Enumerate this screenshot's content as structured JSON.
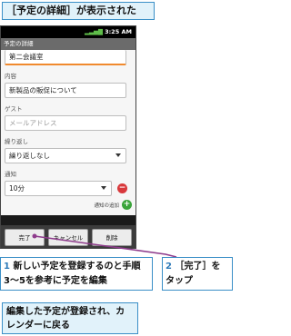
{
  "top_callout": "［予定の詳細］が表示された",
  "phone": {
    "status_time": "3:25 AM",
    "screen_title": "予定の詳細",
    "fields": {
      "location_value": "第二会議室",
      "content_label": "内容",
      "content_value": "新製品の販促について",
      "guest_label": "ゲスト",
      "guest_placeholder": "メールアドレス",
      "repeat_label": "繰り返し",
      "repeat_value": "繰り返しなし",
      "notification_label": "通知",
      "notification_value": "10分",
      "add_notification_label": "通知の追加"
    },
    "buttons": {
      "done": "完了",
      "cancel": "キャンセル",
      "delete": "削除"
    }
  },
  "step1": {
    "number": "1",
    "text": "新しい予定を登録するのと手順3〜5を参考に予定を編集"
  },
  "step2": {
    "number": "2",
    "text": "［完了］をタップ"
  },
  "bottom_callout": "編集した予定が登録され、カレンダーに戻る",
  "colors": {
    "accent": "#3a8fc7",
    "callout_bg": "#e1f2fa",
    "focus": "#f08a2e",
    "pointer": "#8e3b8c"
  }
}
